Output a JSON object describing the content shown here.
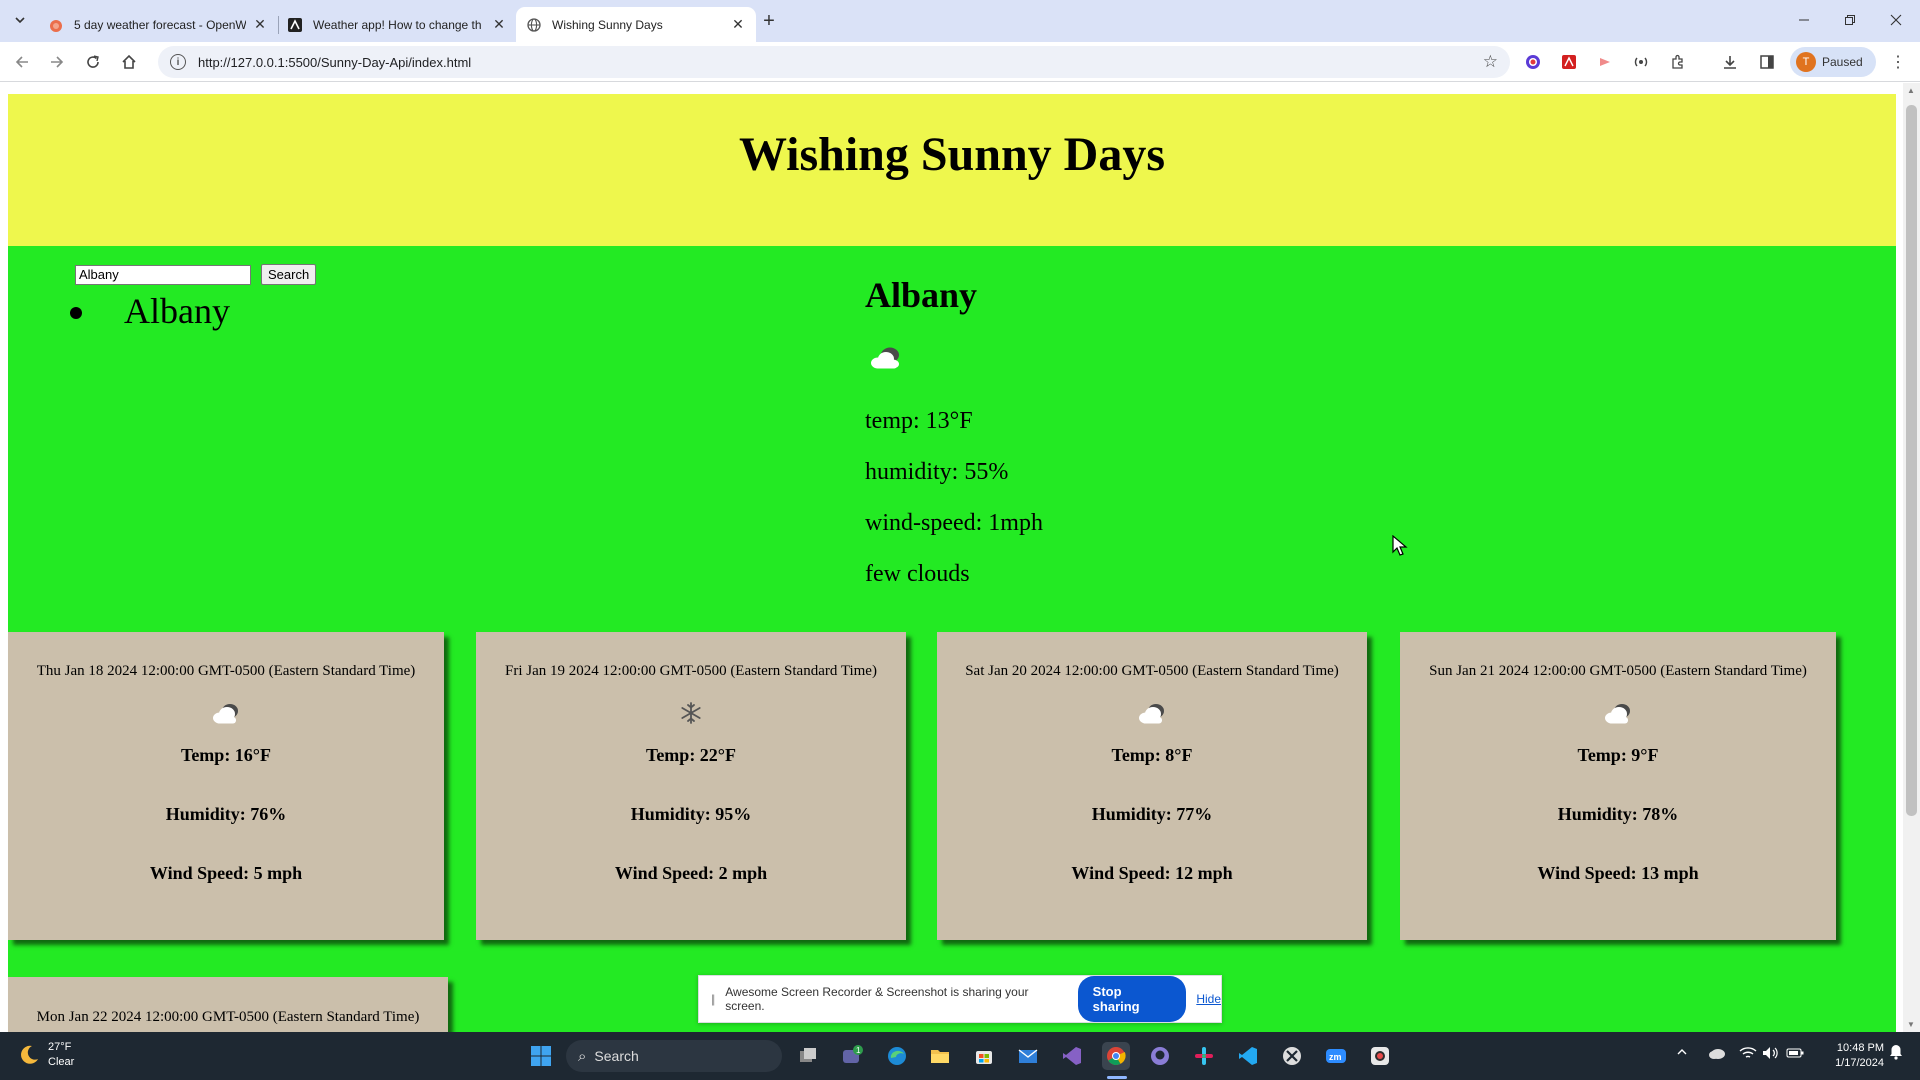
{
  "browser": {
    "tabs": [
      {
        "title": "5 day weather forecast - OpenW",
        "active": false
      },
      {
        "title": "Weather app! How to change th",
        "active": false
      },
      {
        "title": "Wishing Sunny Days",
        "active": true
      }
    ],
    "url": "http://127.0.0.1:5500/Sunny-Day-Api/index.html",
    "profile_initial": "T",
    "profile_label": "Paused"
  },
  "page": {
    "header_title": "Wishing Sunny Days",
    "search": {
      "value": "Albany",
      "button_label": "Search"
    },
    "history": [
      "Albany"
    ],
    "current": {
      "city": "Albany",
      "icon": "broken-clouds-icon",
      "temp": "temp: 13°F",
      "humidity": "humidity: 55%",
      "wind": "wind-speed: 1mph",
      "description": "few clouds"
    },
    "forecast": [
      {
        "date": "Thu Jan 18 2024 12:00:00 GMT-0500 (Eastern Standard Time)",
        "icon": "cloud-icon",
        "temp": "Temp: 16°F",
        "humidity": "Humidity: 76%",
        "wind": "Wind Speed: 5 mph"
      },
      {
        "date": "Fri Jan 19 2024 12:00:00 GMT-0500 (Eastern Standard Time)",
        "icon": "snow-icon",
        "temp": "Temp: 22°F",
        "humidity": "Humidity: 95%",
        "wind": "Wind Speed: 2 mph"
      },
      {
        "date": "Sat Jan 20 2024 12:00:00 GMT-0500 (Eastern Standard Time)",
        "icon": "cloud-icon",
        "temp": "Temp: 8°F",
        "humidity": "Humidity: 77%",
        "wind": "Wind Speed: 12 mph"
      },
      {
        "date": "Sun Jan 21 2024 12:00:00 GMT-0500 (Eastern Standard Time)",
        "icon": "cloud-icon",
        "temp": "Temp: 9°F",
        "humidity": "Humidity: 78%",
        "wind": "Wind Speed: 13 mph"
      },
      {
        "date": "Mon Jan 22 2024 12:00:00 GMT-0500 (Eastern Standard Time)"
      }
    ],
    "colors": {
      "header": "#eef74d",
      "main": "#23ea23",
      "card": "#cbbfab"
    }
  },
  "share_bar": {
    "message": "Awesome Screen Recorder & Screenshot is sharing your screen.",
    "stop_label": "Stop sharing",
    "hide_label": "Hide"
  },
  "taskbar": {
    "weather_temp": "27°F",
    "weather_desc": "Clear",
    "search_label": "Search",
    "teams_badge": "1",
    "time": "10:48 PM",
    "date": "1/17/2024"
  }
}
